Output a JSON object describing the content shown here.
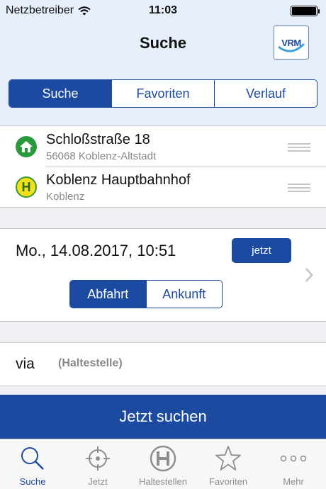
{
  "status_bar": {
    "carrier": "Netzbetreiber",
    "time": "11:03"
  },
  "nav": {
    "title": "Suche",
    "logo_text": "VRM"
  },
  "segments": [
    {
      "label": "Suche",
      "active": true
    },
    {
      "label": "Favoriten",
      "active": false
    },
    {
      "label": "Verlauf",
      "active": false
    }
  ],
  "stops": [
    {
      "name": "Schloßstraße 18",
      "subtitle": "56068 Koblenz-Altstadt",
      "icon": "home-icon"
    },
    {
      "name": "Koblenz Hauptbahnhof",
      "subtitle": "Koblenz",
      "icon": "bus-stop-h-icon"
    }
  ],
  "time_section": {
    "datetime": "Mo., 14.08.2017, 10:51",
    "now_label": "jetzt",
    "departure_label": "Abfahrt",
    "arrival_label": "Ankunft",
    "mode": "Abfahrt"
  },
  "via": {
    "label": "via",
    "placeholder": "(Haltestelle)"
  },
  "search_button": "Jetzt suchen",
  "tabs": [
    {
      "label": "Suche",
      "icon": "magnifier-icon",
      "active": true
    },
    {
      "label": "Jetzt",
      "icon": "crosshair-icon",
      "active": false
    },
    {
      "label": "Haltestellen",
      "icon": "stop-h-icon",
      "active": false
    },
    {
      "label": "Favoriten",
      "icon": "star-icon",
      "active": false
    },
    {
      "label": "Mehr",
      "icon": "more-dots-icon",
      "active": false
    }
  ],
  "colors": {
    "accent": "#1c4aa0",
    "nav_bg": "#e6eefa",
    "home_green": "#2a9a3e",
    "stop_yellow": "#f5e01e"
  }
}
